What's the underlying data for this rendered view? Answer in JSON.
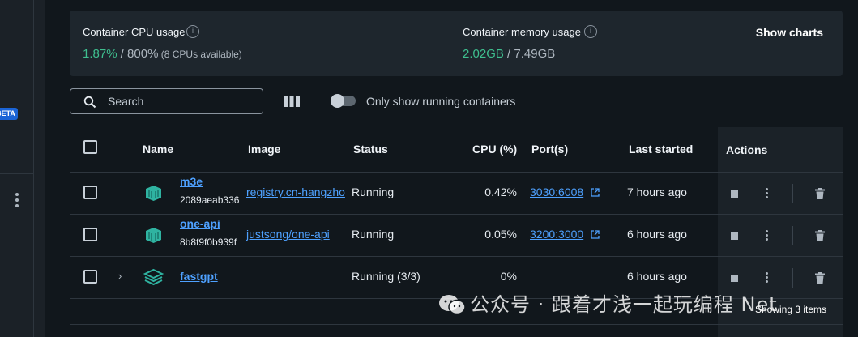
{
  "sidebar": {
    "beta_label": "BETA"
  },
  "stats": {
    "cpu_label": "Container CPU usage",
    "cpu_used": "1.87%",
    "cpu_total": " / 800%",
    "cpu_note": " (8 CPUs available)",
    "memory_label": "Container memory usage",
    "memory_used": "2.02GB",
    "memory_total": " / 7.49GB",
    "show_charts_label": "Show charts"
  },
  "toolbar": {
    "search_placeholder": "Search",
    "toggle_label": "Only show running containers",
    "toggle_on": false
  },
  "table": {
    "columns": [
      "Name",
      "Image",
      "Status",
      "CPU (%)",
      "Port(s)",
      "Last started",
      "Actions"
    ],
    "rows": [
      {
        "name": "m3e",
        "id": "2089aeab336",
        "image": "registry.cn-hangzho",
        "status": "Running",
        "cpu": "0.42%",
        "port": "3030:6008",
        "last_started": "7 hours ago"
      },
      {
        "name": "one-api",
        "id": "8b8f9f0b939f",
        "image": "justsong/one-api",
        "status": "Running",
        "cpu": "0.05%",
        "port": "3200:3000",
        "last_started": "6 hours ago"
      },
      {
        "name": "fastgpt",
        "id": "",
        "image": "",
        "status": "Running (3/3)",
        "cpu": "0%",
        "port": "",
        "last_started": "6 hours ago"
      }
    ],
    "items_count": "Showing 3 items"
  },
  "watermark": {
    "text": "公众号 · 跟着才浅一起玩编程 Net"
  },
  "colors": {
    "accent_green": "#3fbf8f",
    "link_blue": "#4ea1ff",
    "background": "#11171c",
    "beta_blue": "#1b64d6"
  },
  "icons": [
    "search-icon",
    "columns-icon",
    "info-icon",
    "external-link-icon",
    "stop-icon",
    "more-icon",
    "trash-icon",
    "container-icon",
    "stack-icon",
    "chevron-right-icon",
    "wechat-icon"
  ]
}
